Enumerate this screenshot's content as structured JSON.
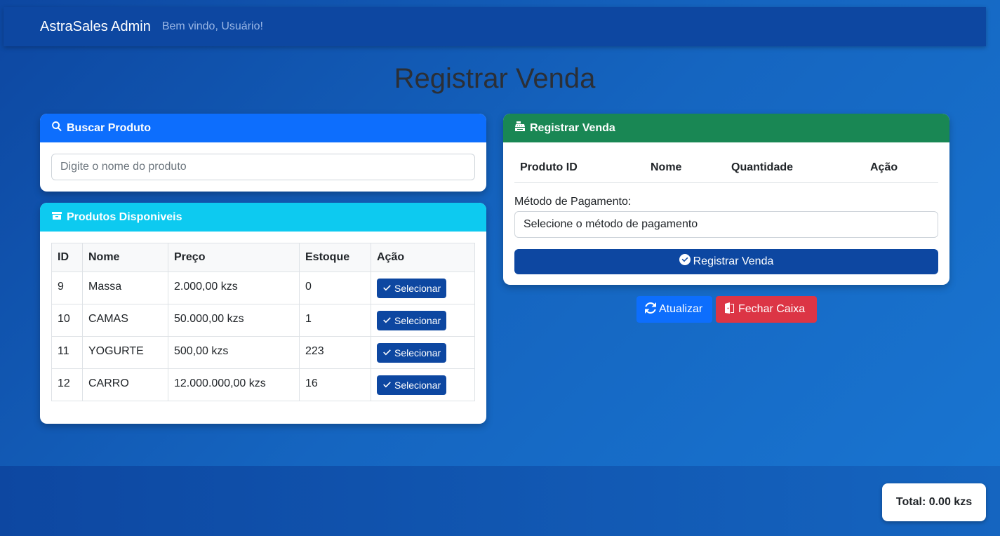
{
  "navbar": {
    "brand": "AstraSales Admin",
    "welcome": "Bem vindo, Usuário!"
  },
  "page_title": "Registrar Venda",
  "search_card": {
    "title": "Buscar Produto",
    "icon": "search-icon",
    "placeholder": "Digite o nome do produto"
  },
  "products_card": {
    "title": "Produtos Disponiveis",
    "icon": "box-icon",
    "columns": [
      "ID",
      "Nome",
      "Preço",
      "Estoque",
      "Ação"
    ],
    "rows": [
      {
        "id": "9",
        "nome": "Massa",
        "preco": "2.000,00 kzs",
        "estoque": "0",
        "acao": "Selecionar"
      },
      {
        "id": "10",
        "nome": "CAMAS",
        "preco": "50.000,00 kzs",
        "estoque": "1",
        "acao": "Selecionar"
      },
      {
        "id": "11",
        "nome": "YOGURTE",
        "preco": "500,00 kzs",
        "estoque": "223",
        "acao": "Selecionar"
      },
      {
        "id": "12",
        "nome": "CARRO",
        "preco": "12.000.000,00 kzs",
        "estoque": "16",
        "acao": "Selecionar"
      }
    ]
  },
  "sale_card": {
    "title": "Registrar Venda",
    "icon": "cash-register-icon",
    "columns": [
      "Produto ID",
      "Nome",
      "Quantidade",
      "Ação"
    ],
    "payment_label": "Método de Pagamento:",
    "payment_value": "Selecione o método de pagamento",
    "register_button": "Registrar Venda"
  },
  "actions": {
    "refresh": "Atualizar",
    "close_register": "Fechar Caixa"
  },
  "total": "Total: 0.00 kzs",
  "colors": {
    "primary": "#0d6efd",
    "info": "#0dcaf0",
    "success": "#198754",
    "danger": "#dc3545",
    "navy": "#0d47a1"
  }
}
